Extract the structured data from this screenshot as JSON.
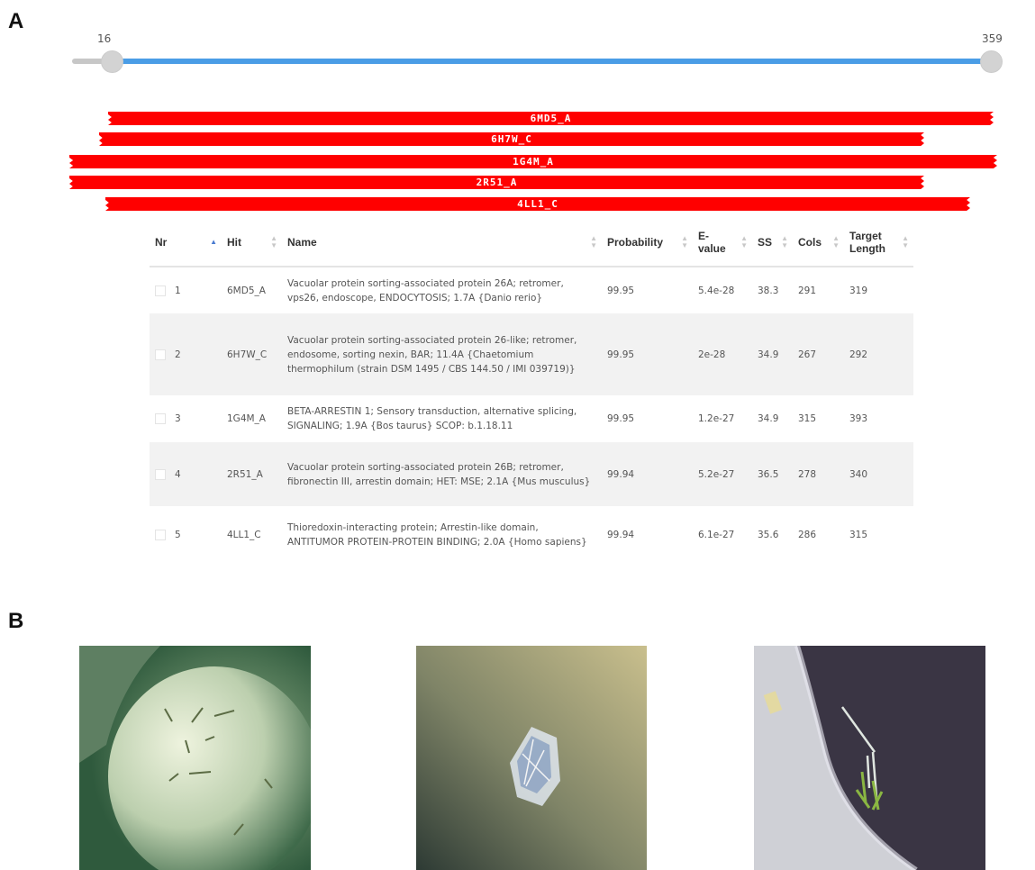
{
  "panels": {
    "a_label": "A",
    "b_label": "B"
  },
  "range_slider": {
    "min_label": "16",
    "max_label": "359",
    "track_color": "#4a9de6"
  },
  "hit_bars": [
    {
      "id": "6MD5_A"
    },
    {
      "id": "6H7W_C"
    },
    {
      "id": "1G4M_A"
    },
    {
      "id": "2R51_A"
    },
    {
      "id": "4LL1_C"
    }
  ],
  "table": {
    "columns": [
      "Nr",
      "Hit",
      "Name",
      "Probability",
      "E-value",
      "SS",
      "Cols",
      "Target Length"
    ],
    "rows": [
      {
        "nr": "1",
        "hit": "6MD5_A",
        "name": "Vacuolar protein sorting-associated protein 26A; retromer, vps26, endoscope, ENDOCYTOSIS; 1.7A {Danio rerio}",
        "probability": "99.95",
        "evalue": "5.4e-28",
        "ss": "38.3",
        "cols": "291",
        "target_length": "319"
      },
      {
        "nr": "2",
        "hit": "6H7W_C",
        "name": "Vacuolar protein sorting-associated protein 26-like; retromer, endosome, sorting nexin, BAR; 11.4A {Chaetomium thermophilum (strain DSM 1495 / CBS 144.50 / IMI 039719)}",
        "probability": "99.95",
        "evalue": "2e-28",
        "ss": "34.9",
        "cols": "267",
        "target_length": "292"
      },
      {
        "nr": "3",
        "hit": "1G4M_A",
        "name": "BETA-ARRESTIN 1; Sensory transduction, alternative splicing, SIGNALING; 1.9A {Bos taurus} SCOP: b.1.18.11",
        "probability": "99.95",
        "evalue": "1.2e-27",
        "ss": "34.9",
        "cols": "315",
        "target_length": "393"
      },
      {
        "nr": "4",
        "hit": "2R51_A",
        "name": "Vacuolar protein sorting-associated protein 26B; retromer, fibronectin III, arrestin domain; HET: MSE; 2.1A {Mus musculus}",
        "probability": "99.94",
        "evalue": "5.2e-27",
        "ss": "36.5",
        "cols": "278",
        "target_length": "340"
      },
      {
        "nr": "5",
        "hit": "4LL1_C",
        "name": "Thioredoxin-interacting protein; Arrestin-like domain, ANTITUMOR PROTEIN-PROTEIN BINDING; 2.0A {Homo sapiens}",
        "probability": "99.94",
        "evalue": "6.1e-27",
        "ss": "35.6",
        "cols": "286",
        "target_length": "315"
      }
    ]
  },
  "colors": {
    "hit_bar": "#ff0000",
    "row_alt": "#f2f2f2",
    "sort_active": "#4a7bd0"
  }
}
